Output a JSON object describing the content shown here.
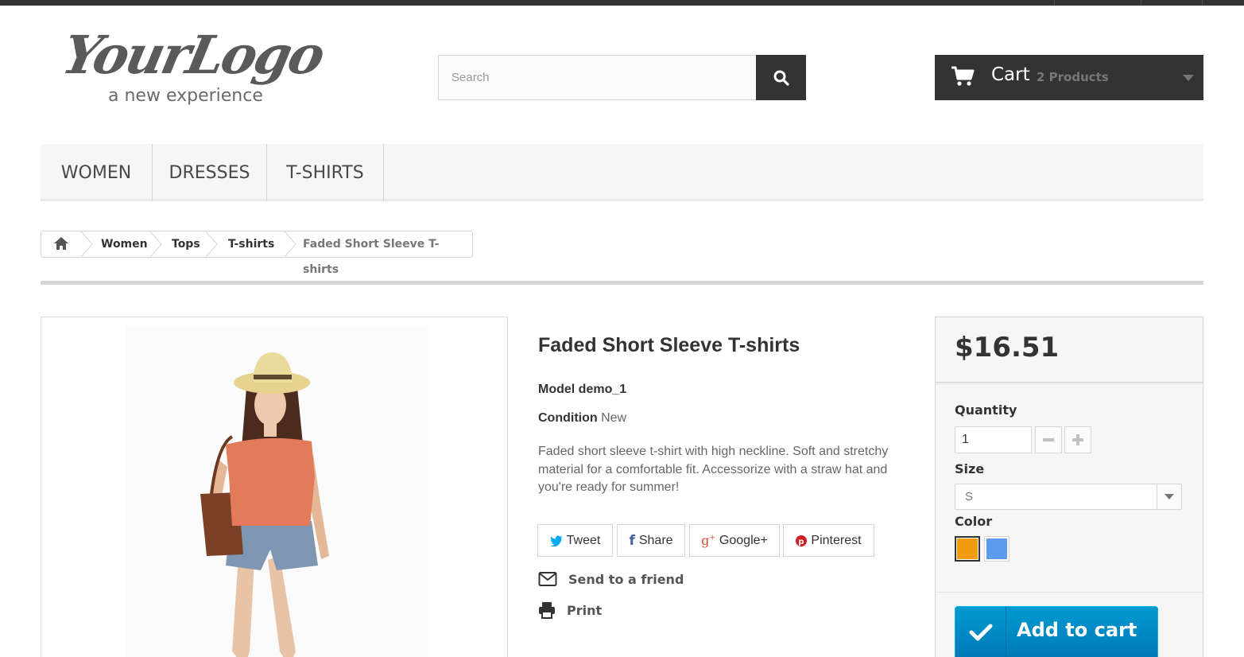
{
  "header": {
    "logo_text": "YourLogo",
    "logo_tagline": "a new experience",
    "search_placeholder": "Search",
    "cart_title": "Cart",
    "cart_count": "2 Products"
  },
  "nav": {
    "items": [
      {
        "label": "WOMEN"
      },
      {
        "label": "DRESSES"
      },
      {
        "label": "T-SHIRTS"
      }
    ]
  },
  "breadcrumb": {
    "items": [
      "Women",
      "Tops",
      "T-shirts"
    ],
    "current": "Faded Short Sleeve T-shirts"
  },
  "product": {
    "title": "Faded Short Sleeve T-shirts",
    "model_label": "Model",
    "model_value": "demo_1",
    "condition_label": "Condition",
    "condition_value": "New",
    "description": "Faded short sleeve t-shirt with high neckline. Soft and stretchy material for a comfortable fit. Accessorize with a straw hat and you're ready for summer!",
    "social": {
      "tweet": "Tweet",
      "share": "Share",
      "google": "Google+",
      "pinterest": "Pinterest"
    },
    "send_to_friend": "Send to a friend",
    "print": "Print"
  },
  "buybox": {
    "price": "$16.51",
    "quantity_label": "Quantity",
    "quantity_value": "1",
    "size_label": "Size",
    "size_value": "S",
    "color_label": "Color",
    "colors": [
      "#f39c11",
      "#5d9cec"
    ],
    "add_to_cart": "Add to cart"
  },
  "colors": {
    "dark": "#333333",
    "accent_blue": "#009ad0",
    "twitter": "#00aaf0",
    "facebook": "#435f9f",
    "google": "#e04b34",
    "pinterest": "#ce1f21"
  }
}
